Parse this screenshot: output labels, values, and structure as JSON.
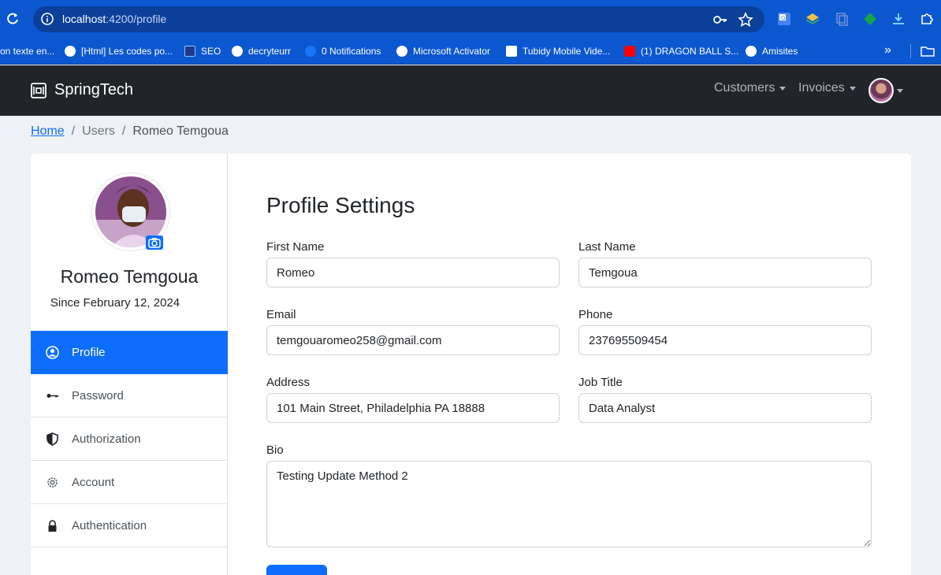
{
  "browser": {
    "url_host": "localhost",
    "url_path": ":4200/profile",
    "bookmarks": [
      {
        "label": "on texte en..."
      },
      {
        "label": "[Html] Les codes po..."
      },
      {
        "label": "SEO"
      },
      {
        "label": "decryteurr"
      },
      {
        "label": "0 Notifications"
      },
      {
        "label": "Microsoft Activator"
      },
      {
        "label": "Tubidy Mobile Vide..."
      },
      {
        "label": "(1) DRAGON BALL S..."
      },
      {
        "label": "Amisites"
      }
    ],
    "more_label": "»"
  },
  "navbar": {
    "brand": "SpringTech",
    "customers_label": "Customers",
    "invoices_label": "Invoices"
  },
  "breadcrumb": {
    "home": "Home",
    "separator": "/",
    "users": "Users",
    "current": "Romeo Temgoua"
  },
  "sidebar": {
    "name": "Romeo Temgoua",
    "since": "Since February 12, 2024",
    "items": [
      {
        "label": "Profile",
        "icon": "person-circle-icon",
        "active": true
      },
      {
        "label": "Password",
        "icon": "key-icon",
        "active": false
      },
      {
        "label": "Authorization",
        "icon": "shield-icon",
        "active": false
      },
      {
        "label": "Account",
        "icon": "gear-icon",
        "active": false
      },
      {
        "label": "Authentication",
        "icon": "lock-icon",
        "active": false
      }
    ]
  },
  "form": {
    "title": "Profile Settings",
    "first_name_label": "First Name",
    "first_name_value": "Romeo",
    "last_name_label": "Last Name",
    "last_name_value": "Temgoua",
    "email_label": "Email",
    "email_value": "temgouaromeo258@gmail.com",
    "phone_label": "Phone",
    "phone_value": "237695509454",
    "address_label": "Address",
    "address_value": "101 Main Street, Philadelphia PA 18888",
    "job_title_label": "Job Title",
    "job_title_value": "Data Analyst",
    "bio_label": "Bio",
    "bio_value": "Testing Update Method 2"
  },
  "colors": {
    "primary": "#0d6efd",
    "navbar": "#212529",
    "chrome": "#0b57d0"
  }
}
